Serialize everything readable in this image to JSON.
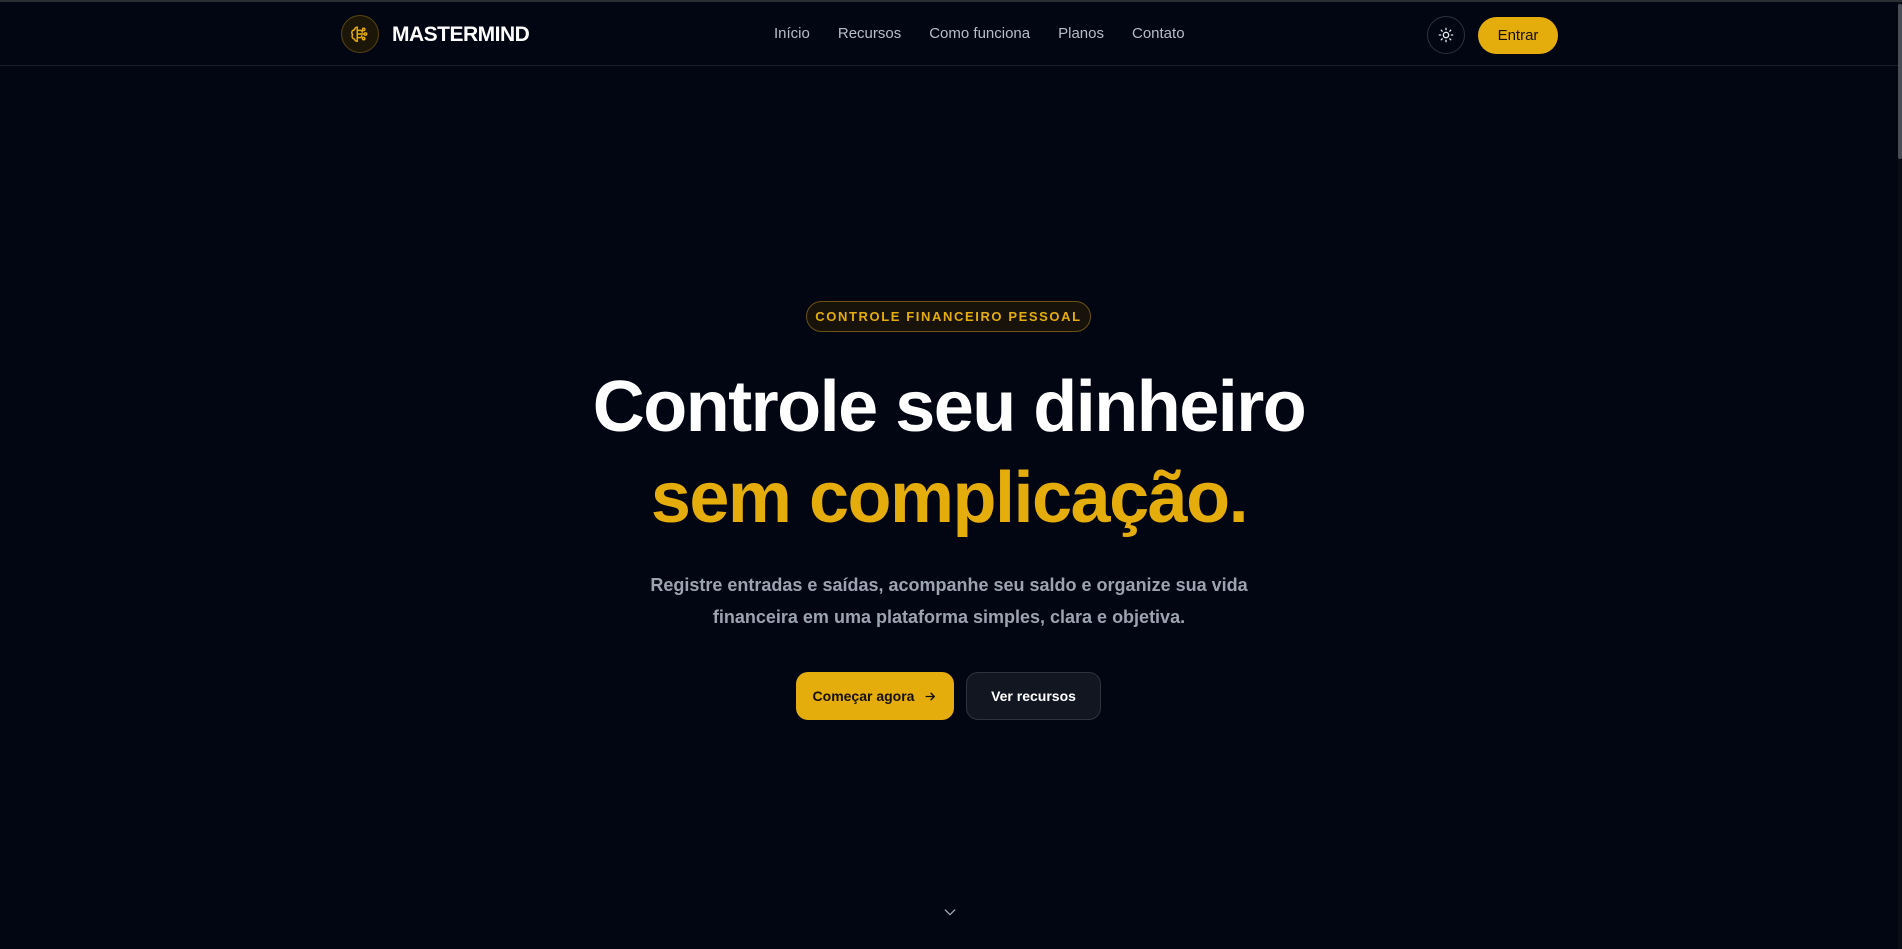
{
  "brand": {
    "name": "MASTERMIND",
    "logo_icon": "brain-icon",
    "accent": "#e4ad0b"
  },
  "nav": {
    "items": [
      {
        "label": "Início"
      },
      {
        "label": "Recursos"
      },
      {
        "label": "Como funciona"
      },
      {
        "label": "Planos"
      },
      {
        "label": "Contato"
      }
    ]
  },
  "header_actions": {
    "theme_toggle_icon": "sun-icon",
    "login_label": "Entrar"
  },
  "hero": {
    "badge": "CONTROLE FINANCEIRO PESSOAL",
    "title_line1": "Controle seu dinheiro",
    "title_line2": "sem complicação.",
    "subtitle_line1": "Registre entradas e saídas, acompanhe seu saldo e organize sua vida",
    "subtitle_line2": "financeira em uma plataforma simples, clara e objetiva.",
    "primary_cta": "Começar agora",
    "primary_cta_icon": "arrow-right-icon",
    "secondary_cta": "Ver recursos",
    "scroll_icon": "chevron-down-icon"
  },
  "colors": {
    "background": "#020612",
    "accent": "#e4ad0b",
    "text_primary": "#ffffff",
    "text_muted": "#9ca3b0"
  }
}
